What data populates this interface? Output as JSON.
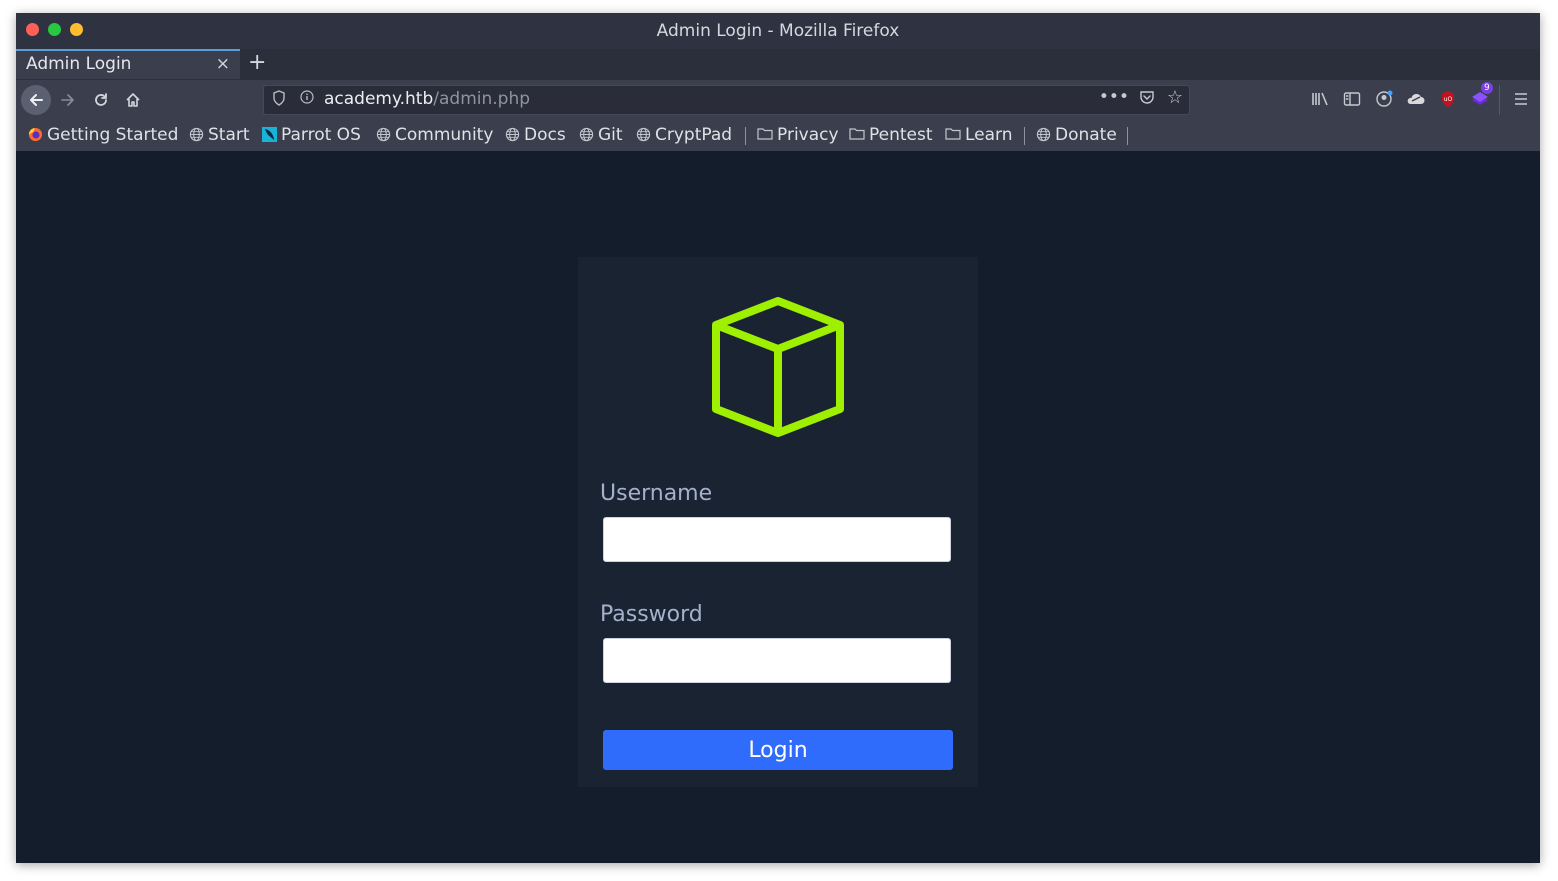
{
  "window": {
    "title": "Admin Login - Mozilla Firefox",
    "traffic_lights": [
      "close",
      "minimize",
      "maximize"
    ]
  },
  "tab": {
    "label": "Admin Login",
    "close_glyph": "×",
    "new_tab_glyph": "+"
  },
  "navbar": {
    "back_icon": "arrow-left-icon",
    "forward_icon": "arrow-right-icon",
    "reload_icon": "reload-icon",
    "home_icon": "home-icon",
    "url_host": "academy.htb",
    "url_path": "/admin.php",
    "extension_badge": "9"
  },
  "bookmarks": {
    "items": [
      {
        "label": "Getting Started",
        "icon": "firefox-icon"
      },
      {
        "label": "Start",
        "icon": "globe-icon"
      },
      {
        "label": "Parrot OS",
        "icon": "parrot-icon"
      },
      {
        "label": "Community",
        "icon": "globe-icon"
      },
      {
        "label": "Docs",
        "icon": "globe-icon"
      },
      {
        "label": "Git",
        "icon": "globe-icon"
      },
      {
        "label": "CryptPad",
        "icon": "globe-icon"
      },
      {
        "label": "Privacy",
        "icon": "folder-icon"
      },
      {
        "label": "Pentest",
        "icon": "folder-icon"
      },
      {
        "label": "Learn",
        "icon": "folder-icon"
      },
      {
        "label": "Donate",
        "icon": "globe-icon"
      }
    ]
  },
  "login": {
    "logo_icon": "cube-icon",
    "username_label": "Username",
    "username_value": "",
    "password_label": "Password",
    "password_value": "",
    "button_label": "Login"
  },
  "colors": {
    "page_bg": "#141d2b",
    "card_bg": "#1a2332",
    "accent_green": "#9fef00",
    "button_blue": "#2f6cfb",
    "label": "#a4b1cd"
  }
}
